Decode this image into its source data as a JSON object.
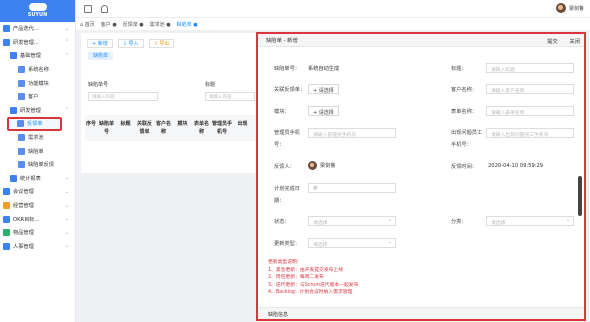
{
  "brand": {
    "logo_text": "SUYUN"
  },
  "sidebar": [
    {
      "label": "产品迭代...",
      "level": 0,
      "color": "#3d82f0",
      "chev": "⌄"
    },
    {
      "label": "研发管理...",
      "level": 0,
      "color": "#3d82f0",
      "chev": "⌃"
    },
    {
      "label": "基础管理",
      "level": 1,
      "color": "#3d82f0",
      "chev": "⌃"
    },
    {
      "label": "系统名称",
      "level": 2,
      "color": "#5a8dee",
      "chev": ""
    },
    {
      "label": "功能模块",
      "level": 2,
      "color": "#5a8dee",
      "chev": ""
    },
    {
      "label": "客户",
      "level": 2,
      "color": "#5a8dee",
      "chev": ""
    },
    {
      "label": "研发管理",
      "level": 1,
      "color": "#3d82f0",
      "chev": "⌃"
    },
    {
      "label": "反馈单",
      "level": 2,
      "color": "#5a8dee",
      "chev": "",
      "active": true
    },
    {
      "label": "需求池",
      "level": 2,
      "color": "#5a8dee",
      "chev": ""
    },
    {
      "label": "缺陷单",
      "level": 2,
      "color": "#5a8dee",
      "chev": ""
    },
    {
      "label": "缺陷单反馈",
      "level": 2,
      "color": "#5a8dee",
      "chev": ""
    },
    {
      "label": "统计报表",
      "level": 1,
      "color": "#3d82f0",
      "chev": "⌄"
    },
    {
      "label": "会议管理",
      "level": 0,
      "color": "#3d82f0",
      "chev": "⌄"
    },
    {
      "label": "经营管理",
      "level": 0,
      "color": "#f0a020",
      "chev": "⌄"
    },
    {
      "label": "OKR目标...",
      "level": 0,
      "color": "#3d82f0",
      "chev": "⌄"
    },
    {
      "label": "物品管理",
      "level": 0,
      "color": "#2ab06f",
      "chev": "⌄"
    },
    {
      "label": "人事管理",
      "level": 0,
      "color": "#3d82f0",
      "chev": "⌄"
    }
  ],
  "user": {
    "name": "梁剑鲁"
  },
  "tabs": [
    {
      "label": "⌂ 首页",
      "cur": false
    },
    {
      "label": "客户 ●",
      "cur": false
    },
    {
      "label": "反馈单 ●",
      "cur": false
    },
    {
      "label": "需求池 ●",
      "cur": false
    },
    {
      "label": "缺陷单 ●",
      "cur": true
    }
  ],
  "list": {
    "new_label": "+ 新增",
    "import_label": "⇩ 导入",
    "export_label": "⇧ 导出",
    "subtab": "缺陷单",
    "field1_label": "缺陷单号",
    "field1_ph": "请输入内容",
    "field2_label": "标题",
    "field2_ph": "请输入内容",
    "columns": [
      "序号",
      "缺陷单号",
      "标题",
      "关联反馈单",
      "客户名称",
      "模块",
      "表单名称",
      "管理员手机号",
      "出现"
    ]
  },
  "modal": {
    "title": "缺陷单 - 新增",
    "submit": "提交",
    "close": "关闭",
    "no_label": "缺陷单号：",
    "no_value": "系统自动生成",
    "title_label": "标题：",
    "title_ph": "请输入标题",
    "feedback_label": "关联反馈单：",
    "select_btn": "+ 请选择",
    "customer_label": "客户名称：",
    "customer_ph": "请输入客户名称",
    "module_label": "模块：",
    "form_label": "表单名称：",
    "form_ph": "请输入表单名称",
    "admin_label1": "管理员手机",
    "admin_label2": "号：",
    "admin_ph": "请输入管理员手机号",
    "found_label1": "出现问题员工",
    "found_label2": "手机号：",
    "found_ph": "请输入出现问题员工手机号",
    "reporter_label": "反馈人：",
    "reporter_name": "梁剑鲁",
    "time_label": "反馈时间：",
    "time_value": "2020-04-10 09:59:29",
    "plan_label1": "计划完成日",
    "plan_label2": "期：",
    "status_label": "状态：",
    "status_ph": "请选择",
    "category_label": "分类：",
    "category_ph": "请选择",
    "update_label": "更新类型：",
    "update_ph": "请选择",
    "notes": [
      "更新类型说明：",
      "1、紧急更新：由开发提交发布上线",
      "2、周包更新：每周二发布",
      "3、迭代更新：与Scrum迭代版本一起发布",
      "4、Backlog：计划会议时纳入需求管理"
    ],
    "section": "缺陷信息"
  }
}
